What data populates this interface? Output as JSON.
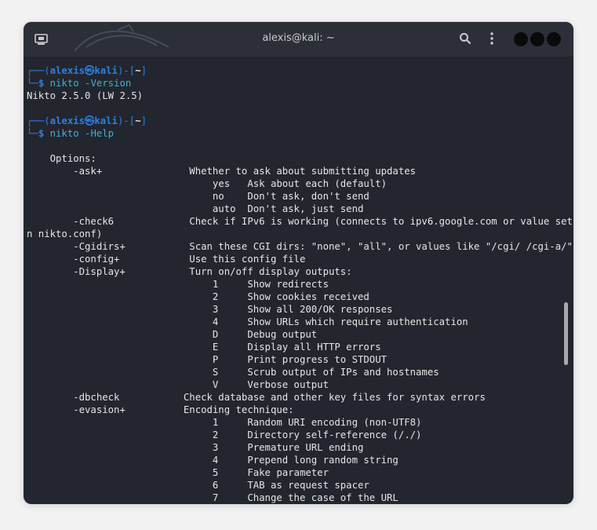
{
  "window": {
    "title": "alexis@kali: ~"
  },
  "icons": {
    "new_tab": "new-tab-icon",
    "search": "search-icon",
    "menu": "kebab-menu-icon",
    "window_controls": [
      "minimize-icon",
      "maximize-icon",
      "close-icon"
    ]
  },
  "colors": {
    "terminal_bg": "#23262f",
    "titlebar_bg": "#2c2f38",
    "prompt_blue": "#2f7fe0",
    "command_cyan": "#3fb2d4",
    "text": "#e6e6e6"
  },
  "prompts": [
    {
      "top_deco": "┌──(",
      "user": "alexis㉿kali",
      "mid_deco": ")-[",
      "path": "~",
      "end_deco": "]",
      "bottom_deco": "└─",
      "dollar": "$",
      "command": "nikto -Version"
    },
    {
      "top_deco": "┌──(",
      "user": "alexis㉿kali",
      "mid_deco": ")-[",
      "path": "~",
      "end_deco": "]",
      "bottom_deco": "└─",
      "dollar": "$",
      "command": "nikto -Help"
    }
  ],
  "output": {
    "version": "Nikto 2.5.0 (LW 2.5)",
    "help": [
      "    Options:",
      "        -ask+               Whether to ask about submitting updates",
      "                                yes   Ask about each (default)",
      "                                no    Don't ask, don't send",
      "                                auto  Don't ask, just send",
      "        -check6             Check if IPv6 is working (connects to ipv6.google.com or value set i",
      "n nikto.conf)",
      "        -Cgidirs+           Scan these CGI dirs: \"none\", \"all\", or values like \"/cgi/ /cgi-a/\"",
      "        -config+            Use this config file",
      "        -Display+           Turn on/off display outputs:",
      "                                1     Show redirects",
      "                                2     Show cookies received",
      "                                3     Show all 200/OK responses",
      "                                4     Show URLs which require authentication",
      "                                D     Debug output",
      "                                E     Display all HTTP errors",
      "                                P     Print progress to STDOUT",
      "                                S     Scrub output of IPs and hostnames",
      "                                V     Verbose output",
      "        -dbcheck           Check database and other key files for syntax errors",
      "        -evasion+          Encoding technique:",
      "                                1     Random URI encoding (non-UTF8)",
      "                                2     Directory self-reference (/./)",
      "                                3     Premature URL ending",
      "                                4     Prepend long random string",
      "                                5     Fake parameter",
      "                                6     TAB as request spacer",
      "                                7     Change the case of the URL"
    ]
  }
}
